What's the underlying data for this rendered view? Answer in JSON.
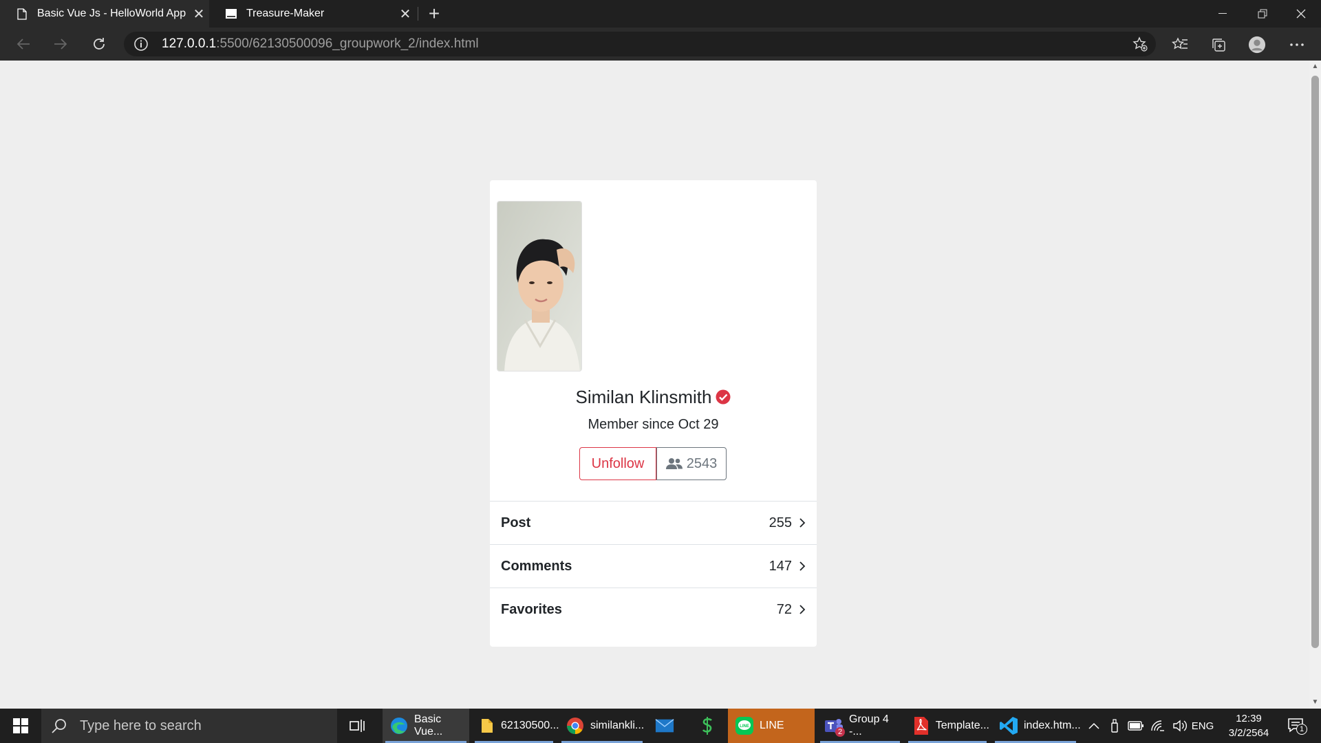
{
  "browser": {
    "tabs": [
      {
        "title": "Basic Vue Js - HelloWorld App",
        "active": true
      },
      {
        "title": "Treasure-Maker",
        "active": false
      }
    ],
    "url_host": "127.0.0.1",
    "url_rest": ":5500/62130500096_groupwork_2/index.html"
  },
  "profile": {
    "name": "Similan Klinsmith",
    "member_since": "Member since Oct 29",
    "unfollow_label": "Unfollow",
    "followers": "2543",
    "stats": [
      {
        "label": "Post",
        "count": "255"
      },
      {
        "label": "Comments",
        "count": "147"
      },
      {
        "label": "Favorites",
        "count": "72"
      }
    ]
  },
  "taskbar": {
    "search_placeholder": "Type here to search",
    "apps": [
      {
        "label": "Basic Vue...",
        "icon": "edge-icon"
      },
      {
        "label": "62130500...",
        "icon": "folder-icon"
      },
      {
        "label": "similankli...",
        "icon": "chrome-icon"
      },
      {
        "label": "",
        "icon": "mail-icon"
      },
      {
        "label": "",
        "icon": "dollar-icon"
      },
      {
        "label": "LINE",
        "icon": "line-icon"
      },
      {
        "label": "Group 4 -...",
        "icon": "teams-icon"
      },
      {
        "label": "Template...",
        "icon": "pdf-icon"
      },
      {
        "label": "index.htm...",
        "icon": "vscode-icon"
      }
    ],
    "language": "ENG",
    "time": "12:39",
    "date": "3/2/2564",
    "notification_count": "1",
    "teams_badge": "2"
  },
  "colors": {
    "danger": "#dc3545",
    "secondary": "#6c757d",
    "page_bg": "#eeeeee"
  }
}
